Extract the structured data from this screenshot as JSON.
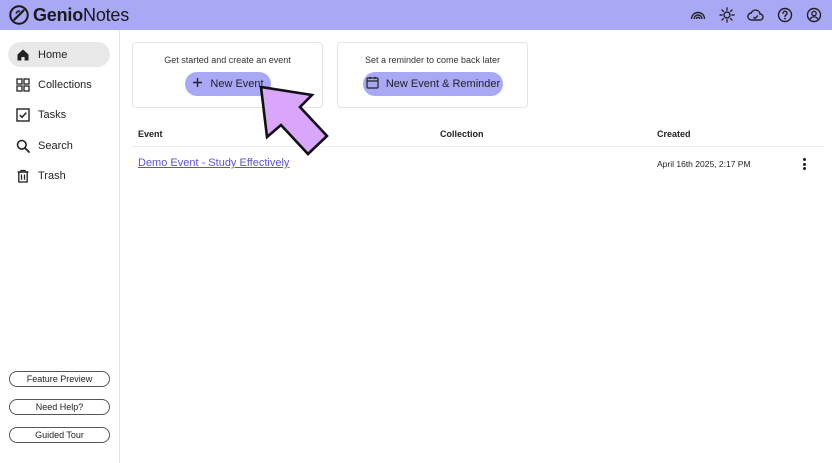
{
  "header": {
    "logo_part1": "Genio",
    "logo_part2": "Notes",
    "icons": [
      "rainbow-icon",
      "sun-icon",
      "cloud-icon",
      "help-icon",
      "user-icon"
    ]
  },
  "sidebar": {
    "items": [
      {
        "label": "Home",
        "icon": "home-icon",
        "active": true
      },
      {
        "label": "Collections",
        "icon": "grid-icon"
      },
      {
        "label": "Tasks",
        "icon": "checkbox-icon"
      },
      {
        "label": "Search",
        "icon": "search-icon"
      },
      {
        "label": "Trash",
        "icon": "trash-icon"
      }
    ],
    "bottom_buttons": [
      "Feature Preview",
      "Need Help?",
      "Guided Tour"
    ]
  },
  "cards": {
    "event": {
      "title": "Get started and create an event",
      "button": "New Event",
      "icon": "plus-icon"
    },
    "reminder": {
      "title": "Set a reminder to come back later",
      "button": "New Event & Reminder",
      "icon": "calendar-icon"
    }
  },
  "table": {
    "headers": {
      "event": "Event",
      "collection": "Collection",
      "created": "Created"
    },
    "rows": [
      {
        "event": "Demo Event - Study Effectively",
        "collection": "",
        "created": "April 16th 2025, 2:17 PM"
      }
    ]
  },
  "colors": {
    "accent": "#a9a8f5",
    "link": "#5b55c9",
    "arrow": "#d9a6fb"
  }
}
